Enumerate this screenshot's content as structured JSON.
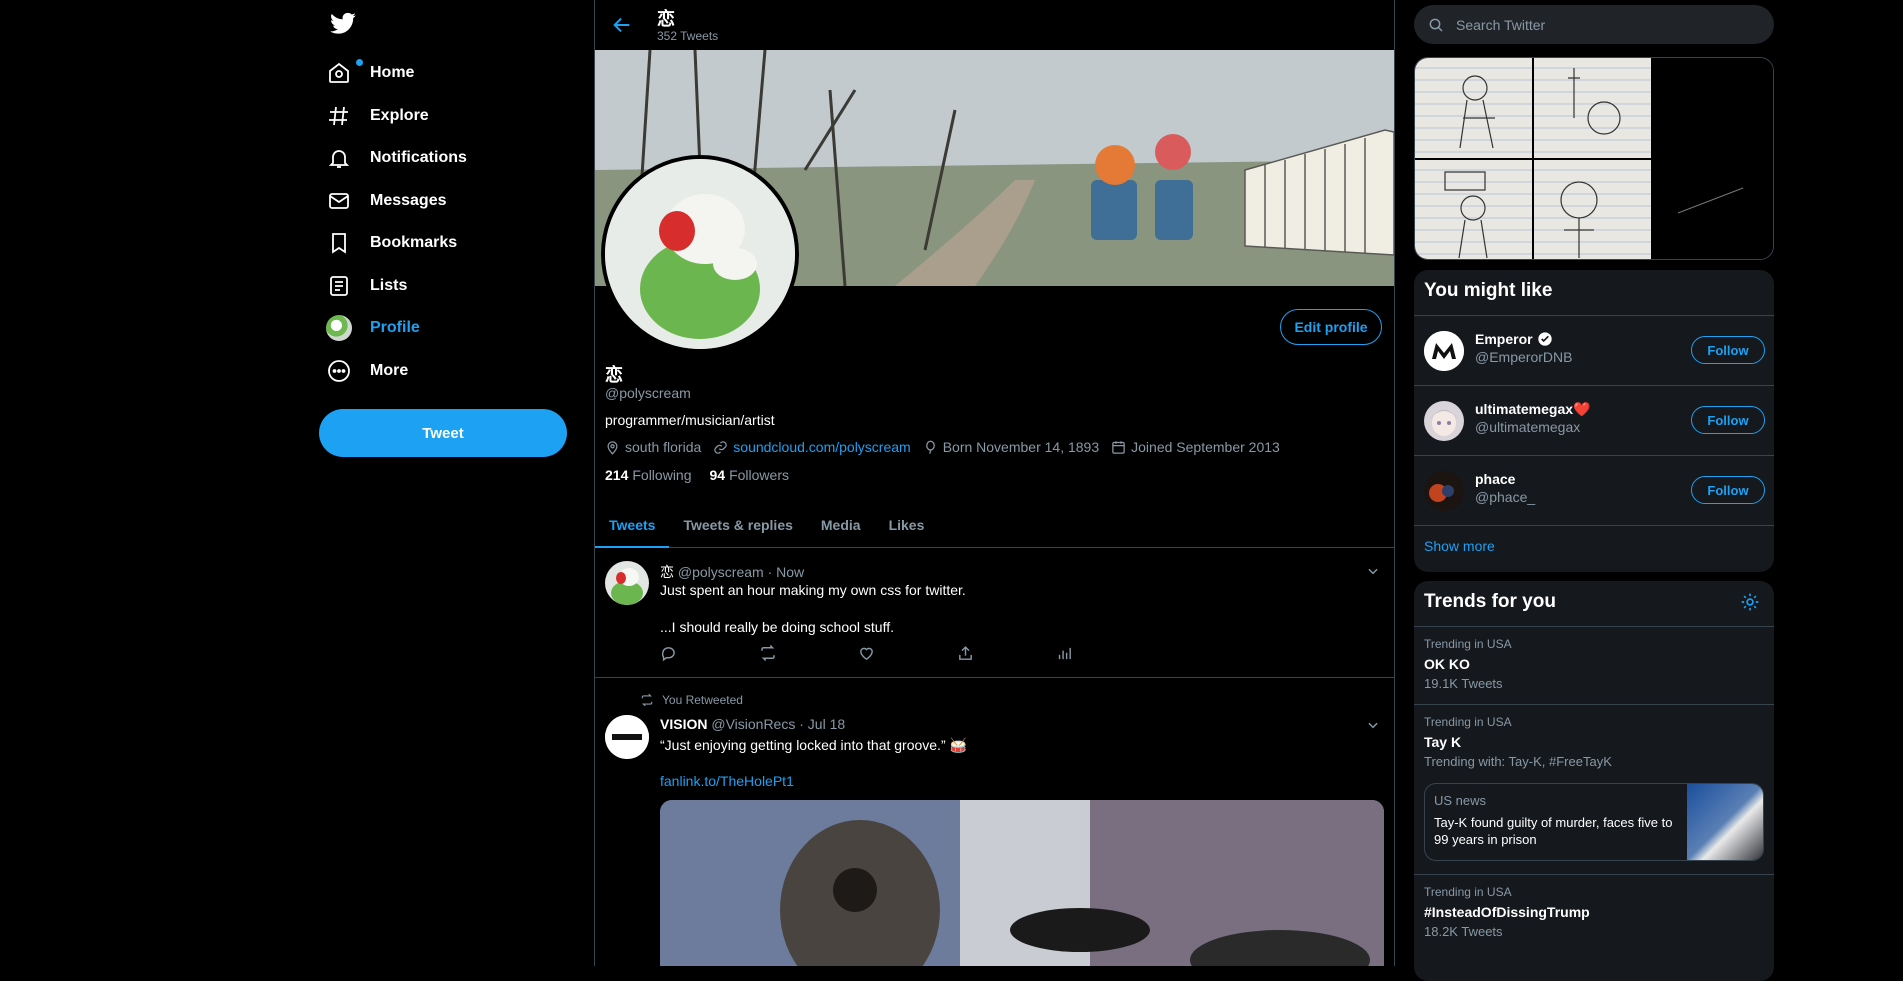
{
  "nav": {
    "items": [
      {
        "label": "Home",
        "icon": "home-icon"
      },
      {
        "label": "Explore",
        "icon": "hashtag-icon"
      },
      {
        "label": "Notifications",
        "icon": "bell-icon"
      },
      {
        "label": "Messages",
        "icon": "mail-icon"
      },
      {
        "label": "Bookmarks",
        "icon": "bookmark-icon"
      },
      {
        "label": "Lists",
        "icon": "list-icon"
      },
      {
        "label": "Profile",
        "icon": "avatar"
      },
      {
        "label": "More",
        "icon": "more-icon"
      }
    ],
    "tweet_label": "Tweet",
    "accent": "#1da1f2"
  },
  "header": {
    "name": "恋",
    "tweet_count": "352 Tweets"
  },
  "profile": {
    "edit_label": "Edit profile",
    "name": "恋",
    "handle": "@polyscream",
    "bio": "programmer/musician/artist",
    "location": "south florida",
    "link": "soundcloud.com/polyscream",
    "born": "Born November 14, 1893",
    "joined": "Joined September 2013",
    "following_count": "214",
    "following_label": "Following",
    "followers_count": "94",
    "followers_label": "Followers"
  },
  "tabs": [
    "Tweets",
    "Tweets & replies",
    "Media",
    "Likes"
  ],
  "tweets": [
    {
      "name": "恋",
      "handle": "@polyscream",
      "time": "· Now",
      "lines": [
        "Just spent an hour making my own css for twitter.",
        "...I should really be doing school stuff."
      ]
    },
    {
      "retweet_label": "You Retweeted",
      "name": "VISION",
      "handle": "@VisionRecs",
      "time": "· Jul 18",
      "text": "“Just enjoying getting locked into that groove.” 🥁",
      "link": "fanlink.to/TheHolePt1"
    }
  ],
  "search": {
    "placeholder": "Search Twitter"
  },
  "who_to_follow": {
    "title": "You might like",
    "users": [
      {
        "name": "Emperor",
        "handle": "@EmperorDNB",
        "verified": true,
        "follow": "Follow"
      },
      {
        "name": "ultimatemegax❤️",
        "handle": "@ultimatemegax",
        "follow": "Follow"
      },
      {
        "name": "phace",
        "handle": "@phace_",
        "follow": "Follow"
      }
    ],
    "show_more": "Show more"
  },
  "trends": {
    "title": "Trends for you",
    "items": [
      {
        "context": "Trending in USA",
        "name": "OK KO",
        "count": "19.1K Tweets"
      },
      {
        "context": "Trending in USA",
        "name": "Tay K",
        "count": "Trending with: Tay-K, #FreeTayK",
        "news_source": "US news",
        "news_text": "Tay-K found guilty of murder, faces five to 99 years in prison"
      },
      {
        "context": "Trending in USA",
        "name": "#InsteadOfDissingTrump",
        "count": "18.2K Tweets"
      }
    ]
  }
}
